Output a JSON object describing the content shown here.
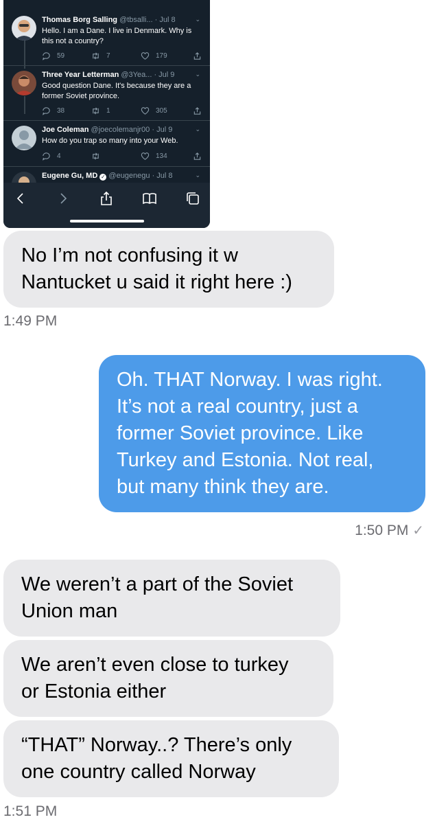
{
  "embedded_screenshot": {
    "tweets": [
      {
        "name": "Thomas Borg Salling",
        "handle": "@tbsalli...",
        "date": "· Jul 8",
        "text": "Hello. I  am a Dane. I live in Denmark. Why is this not a country?",
        "replies": "59",
        "retweets": "7",
        "likes": "179"
      },
      {
        "name": "Three Year Letterman",
        "handle": "@3Yea...",
        "date": "· Jul 9",
        "text": "Good question Dane. It's because they are a former Soviet province.",
        "replies": "38",
        "retweets": "1",
        "likes": "305"
      },
      {
        "name": "Joe Coleman",
        "handle": "@joecolemanjr00",
        "date": "· Jul 9",
        "text": "How do you trap so many into your Web.",
        "replies": "4",
        "retweets": "",
        "likes": "134"
      },
      {
        "name": "Eugene Gu, MD",
        "handle": "@eugenegu",
        "date": "· Jul 8",
        "text": "",
        "replies": "",
        "retweets": "",
        "likes": ""
      }
    ],
    "toolbar_icons": [
      "back-icon",
      "forward-icon",
      "share-icon",
      "bookmarks-icon",
      "tabs-icon"
    ],
    "colors": {
      "background": "#15202b",
      "text": "#ffffff",
      "muted": "#8899a6"
    }
  },
  "messages": [
    {
      "direction": "received",
      "text": "No I’m not confusing it w\nNantucket u said it right here :)"
    },
    {
      "direction": "sent",
      "text": "Oh. THAT Norway. I was right.\nIt’s not a real country, just a\nformer Soviet province. Like\nTurkey and Estonia. Not real,\nbut many think they are."
    },
    {
      "direction": "received",
      "text": "We weren’t a part of the Soviet\nUnion man"
    },
    {
      "direction": "received",
      "text": "We aren’t even close to turkey\nor Estonia either"
    },
    {
      "direction": "received",
      "text": "“THAT” Norway..? There’s only\none country called Norway"
    }
  ],
  "timestamps": {
    "first": "1:49 PM",
    "second": "1:50 PM",
    "third": "1:51 PM"
  },
  "delivery_mark": "✓",
  "colors": {
    "sent_bubble": "#4d9be9",
    "received_bubble": "#e9e9eb",
    "timestamp": "#6b6b70"
  }
}
